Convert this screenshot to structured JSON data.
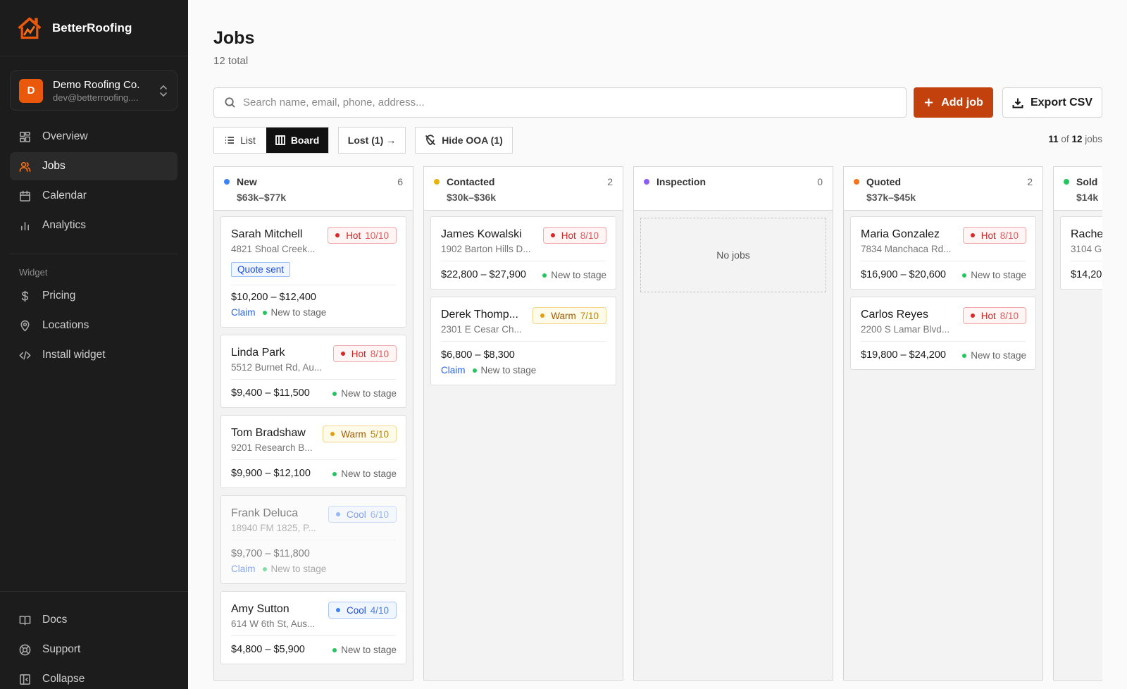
{
  "brand": {
    "name": "BetterRoofing"
  },
  "org": {
    "initial": "D",
    "name": "Demo Roofing Co.",
    "email": "dev@betterroofing...."
  },
  "nav": {
    "overview": "Overview",
    "jobs": "Jobs",
    "calendar": "Calendar",
    "analytics": "Analytics",
    "section_widget": "Widget",
    "pricing": "Pricing",
    "locations": "Locations",
    "install_widget": "Install widget",
    "docs": "Docs",
    "support": "Support",
    "collapse": "Collapse"
  },
  "page": {
    "title": "Jobs",
    "subtitle": "12 total"
  },
  "search": {
    "placeholder": "Search name, email, phone, address..."
  },
  "toolbar": {
    "add_job": "Add job",
    "export_csv": "Export CSV",
    "list": "List",
    "board": "Board",
    "lost": "Lost (1) →",
    "hide_ooa": "Hide OOA (1)",
    "shown": "11",
    "of_text": " of ",
    "total": "12",
    "jobs_word": " jobs"
  },
  "colors": {
    "accent": "#c2410c",
    "new": "#3b82f6",
    "contacted": "#eab308",
    "inspection": "#8b5cf6",
    "quoted": "#f97316",
    "sold": "#22c55e"
  },
  "columns": [
    {
      "title": "New",
      "count": "6",
      "range": "$63k–$77k",
      "cards": [
        {
          "name": "Sarah Mitchell",
          "address": "4821 Shoal Creek...",
          "heat": "Hot",
          "score": "10/10",
          "tag": "Quote sent",
          "price": "$10,200 – $12,400",
          "claim": "Claim",
          "stage": "New to stage"
        },
        {
          "name": "Linda Park",
          "address": "5512 Burnet Rd, Au...",
          "heat": "Hot",
          "score": "8/10",
          "price": "$9,400 – $11,500",
          "stage": "New to stage"
        },
        {
          "name": "Tom Bradshaw",
          "address": "9201 Research B...",
          "heat": "Warm",
          "score": "5/10",
          "price": "$9,900 – $12,100",
          "stage": "New to stage"
        },
        {
          "name": "Frank Deluca",
          "address": "18940 FM 1825, P...",
          "heat": "Cool",
          "score": "6/10",
          "price": "$9,700 – $11,800",
          "claim": "Claim",
          "stage": "New to stage"
        },
        {
          "name": "Amy Sutton",
          "address": "614 W 6th St, Aus...",
          "heat": "Cool",
          "score": "4/10",
          "price": "$4,800 – $5,900",
          "stage": "New to stage"
        }
      ]
    },
    {
      "title": "Contacted",
      "count": "2",
      "range": "$30k–$36k",
      "cards": [
        {
          "name": "James Kowalski",
          "address": "1902 Barton Hills D...",
          "heat": "Hot",
          "score": "8/10",
          "price": "$22,800 – $27,900",
          "stage": "New to stage"
        },
        {
          "name": "Derek Thomp...",
          "address": "2301 E Cesar Ch...",
          "heat": "Warm",
          "score": "7/10",
          "price": "$6,800 – $8,300",
          "claim": "Claim",
          "stage": "New to stage"
        }
      ]
    },
    {
      "title": "Inspection",
      "count": "0",
      "empty": "No jobs"
    },
    {
      "title": "Quoted",
      "count": "2",
      "range": "$37k–$45k",
      "cards": [
        {
          "name": "Maria Gonzalez",
          "address": "7834 Manchaca Rd...",
          "heat": "Hot",
          "score": "8/10",
          "price": "$16,900 – $20,600",
          "stage": "New to stage"
        },
        {
          "name": "Carlos Reyes",
          "address": "2200 S Lamar Blvd...",
          "heat": "Hot",
          "score": "8/10",
          "price": "$19,800 – $24,200",
          "stage": "New to stage"
        }
      ]
    },
    {
      "title": "Sold",
      "range": "$14k",
      "cards": [
        {
          "name": "Rache",
          "address": "3104 G",
          "price": "$14,20"
        }
      ]
    }
  ]
}
